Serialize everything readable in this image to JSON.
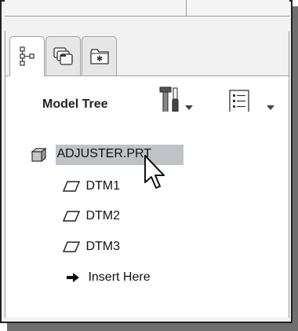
{
  "toolbar": {
    "title": "Model Tree"
  },
  "tabs": [
    {
      "name": "model-tree",
      "icon": "tree-icon"
    },
    {
      "name": "folder-browser",
      "icon": "folder-icon"
    },
    {
      "name": "favorites",
      "icon": "favorites-icon"
    }
  ],
  "tree": {
    "root": {
      "label": "ADJUSTER.PRT",
      "icon": "part-icon",
      "selected": true
    },
    "items": [
      {
        "label": "DTM1",
        "icon": "datum-plane-icon"
      },
      {
        "label": "DTM2",
        "icon": "datum-plane-icon"
      },
      {
        "label": "DTM3",
        "icon": "datum-plane-icon"
      },
      {
        "label": "Insert Here",
        "icon": "arrow-right-icon"
      }
    ]
  }
}
